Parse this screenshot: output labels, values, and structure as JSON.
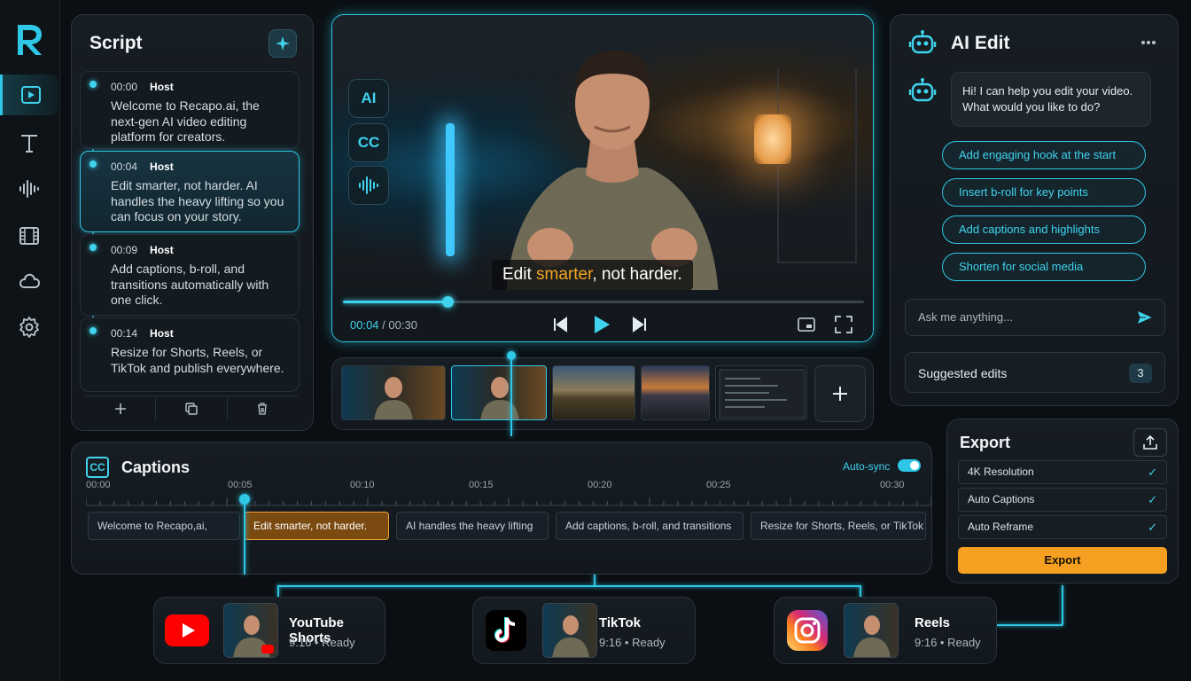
{
  "sidebar": {
    "logo": "R",
    "items": [
      {
        "icon": "play-square-icon",
        "active": true
      },
      {
        "icon": "text-icon"
      },
      {
        "icon": "waveform-icon"
      },
      {
        "icon": "film-icon"
      },
      {
        "icon": "cloud-icon"
      },
      {
        "icon": "gear-icon"
      }
    ]
  },
  "script": {
    "title": "Script",
    "items": [
      {
        "time": "00:00",
        "speaker": "Host",
        "text": "Welcome to Recapo.ai, the next-gen AI video editing platform for creators."
      },
      {
        "time": "00:04",
        "speaker": "Host",
        "text": "Edit smarter, not harder. AI handles the heavy lifting so you can focus on your story.",
        "active": true
      },
      {
        "time": "00:09",
        "speaker": "Host",
        "text": "Add captions, b-roll, and transitions automatically with one click."
      },
      {
        "time": "00:14",
        "speaker": "Host",
        "text": "Resize for Shorts, Reels, or TikTok and publish everywhere."
      }
    ],
    "tools": [
      "plus-icon",
      "duplicate-icon",
      "trash-icon"
    ]
  },
  "player": {
    "tools": {
      "ai": "AI",
      "cc": "CC"
    },
    "subtitle_pre": "Edit ",
    "subtitle_highlight": "smarter",
    "subtitle_post": ", not harder.",
    "current_time": "00:04",
    "total_time": "00:30",
    "progress": 0.2
  },
  "ai_edit": {
    "title": "AI Edit",
    "greeting": "Hi! I can help you edit your video. What would you like to do?",
    "suggestions": [
      "Add engaging hook at the start",
      "Insert b-roll for key points",
      "Add captions and highlights",
      "Shorten for social media"
    ],
    "ask_placeholder": "Ask me anything...",
    "suggested_label": "Suggested edits",
    "suggested_count": "3"
  },
  "captions": {
    "title": "Captions",
    "auto_sync_label": "Auto-sync",
    "ticks": [
      "00:00",
      "00:05",
      "00:10",
      "00:15",
      "00:20",
      "00:25",
      "00:30"
    ],
    "segments": [
      {
        "text": "Welcome to Recapo,ai,"
      },
      {
        "text": "Edit smarter, not harder.",
        "active": true
      },
      {
        "text": "AI handles the heavy lifting"
      },
      {
        "text": "Add captions, b-roll, and transitions"
      },
      {
        "text": "Resize for Shorts, Reels, or TikTok"
      }
    ]
  },
  "export": {
    "title": "Export",
    "options": [
      "4K Resolution",
      "Auto Captions",
      "Auto Reframe"
    ],
    "button": "Export"
  },
  "platforms": [
    {
      "name": "YouTube Shorts",
      "ratio": "9:16",
      "status": "Ready",
      "icon": "youtube-icon"
    },
    {
      "name": "TikTok",
      "ratio": "9:16",
      "status": "Ready",
      "icon": "tiktok-icon"
    },
    {
      "name": "Reels",
      "ratio": "9:16",
      "status": "Ready",
      "icon": "instagram-icon"
    }
  ],
  "colors": {
    "accent": "#2ec8e6",
    "highlight": "#f5a623",
    "export": "#f5a020"
  }
}
